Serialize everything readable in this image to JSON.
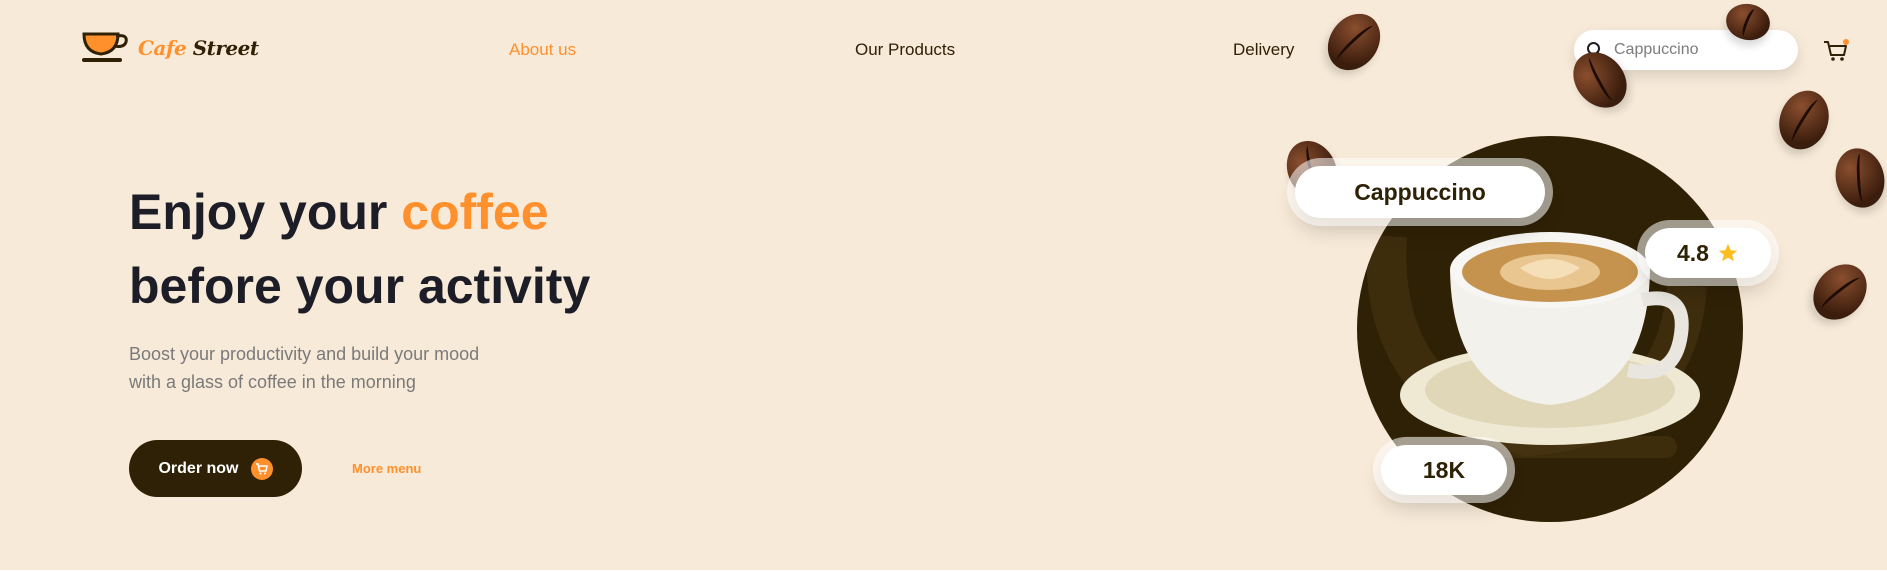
{
  "brand": {
    "word1": "Cafe",
    "word2": "Street"
  },
  "nav": {
    "about": "About us",
    "products": "Our Products",
    "delivery": "Delivery"
  },
  "search": {
    "value": "Cappuccino",
    "icon": "search-icon"
  },
  "cart": {
    "icon": "cart-icon"
  },
  "hero": {
    "title_part1": "Enjoy your ",
    "title_accent": "coffee",
    "title_part2": "before your activity",
    "subtitle_line1": "Boost your productivity and build your mood",
    "subtitle_line2": "with a glass of coffee in the morning",
    "order_label": "Order now",
    "more_label": "More menu"
  },
  "product": {
    "name": "Cappuccino",
    "rating": "4.8",
    "count": "18K"
  },
  "colors": {
    "background": "#f8ead8",
    "accent": "#ff902b",
    "dark": "#2f2105",
    "star": "#fbbe21"
  }
}
